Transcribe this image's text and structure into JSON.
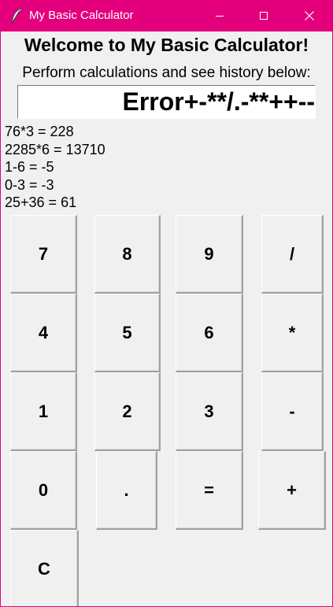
{
  "window": {
    "title": "My Basic Calculator",
    "icon": "feather-icon",
    "accent_color": "#e4007c"
  },
  "controls": {
    "minimize": "minimize-icon",
    "maximize": "maximize-icon",
    "close": "close-icon"
  },
  "header": {
    "welcome": "Welcome to My Basic Calculator!",
    "subtitle": "Perform calculations and see history below:"
  },
  "display": {
    "value": "Error+-**/.-**++--"
  },
  "history": [
    "76*3 = 228",
    "2285*6 = 13710",
    "1-6 = -5",
    "0-3 = -3",
    "25+36 = 61"
  ],
  "keys": {
    "k7": "7",
    "k8": "8",
    "k9": "9",
    "div": "/",
    "k4": "4",
    "k5": "5",
    "k6": "6",
    "mul": "*",
    "k1": "1",
    "k2": "2",
    "k3": "3",
    "sub": "-",
    "k0": "0",
    "dot": ".",
    "eq": "=",
    "add": "+",
    "clear": "C"
  }
}
